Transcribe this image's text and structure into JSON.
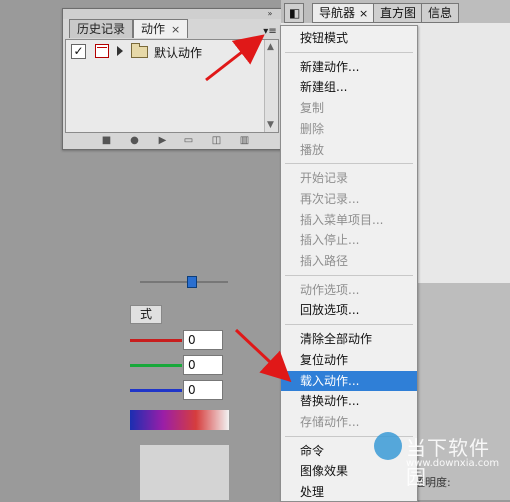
{
  "actions_panel": {
    "tabs": [
      {
        "label": "历史记录",
        "active": false
      },
      {
        "label": "动作",
        "active": true,
        "close": "×"
      }
    ],
    "collapse_icon": "»",
    "menu_icon": "▾≡",
    "rows": [
      {
        "checked": "✓",
        "label": "默认动作"
      }
    ],
    "footer_icons": [
      "stop-icon",
      "record-icon",
      "play-icon",
      "folder-icon",
      "new-action-icon",
      "trash-icon"
    ]
  },
  "navigator_panel": {
    "tabs": [
      {
        "label": "导航器",
        "active": true,
        "close": "×"
      },
      {
        "label": "直方图",
        "active": false
      },
      {
        "label": "信息",
        "active": false
      }
    ],
    "color_tab_label": "式",
    "channels": [
      {
        "name": "red",
        "color": "#c81e1e",
        "value": "0"
      },
      {
        "name": "green",
        "color": "#18a83a",
        "value": "0"
      },
      {
        "name": "blue",
        "color": "#1f35c9",
        "value": "0"
      }
    ],
    "side_label": "透明度:"
  },
  "context_menu": {
    "items": [
      {
        "label": "按钮模式",
        "disabled": false,
        "selected": false
      },
      {
        "sep": true
      },
      {
        "label": "新建动作...",
        "disabled": false,
        "selected": false
      },
      {
        "label": "新建组...",
        "disabled": false,
        "selected": false
      },
      {
        "label": "复制",
        "disabled": true,
        "selected": false
      },
      {
        "label": "删除",
        "disabled": true,
        "selected": false
      },
      {
        "label": "播放",
        "disabled": true,
        "selected": false
      },
      {
        "sep": true
      },
      {
        "label": "开始记录",
        "disabled": true,
        "selected": false
      },
      {
        "label": "再次记录...",
        "disabled": true,
        "selected": false
      },
      {
        "label": "插入菜单项目...",
        "disabled": true,
        "selected": false
      },
      {
        "label": "插入停止...",
        "disabled": true,
        "selected": false
      },
      {
        "label": "插入路径",
        "disabled": true,
        "selected": false
      },
      {
        "sep": true
      },
      {
        "label": "动作选项...",
        "disabled": true,
        "selected": false
      },
      {
        "label": "回放选项...",
        "disabled": false,
        "selected": false
      },
      {
        "sep": true
      },
      {
        "label": "清除全部动作",
        "disabled": false,
        "selected": false
      },
      {
        "label": "复位动作",
        "disabled": false,
        "selected": false
      },
      {
        "label": "载入动作...",
        "disabled": false,
        "selected": true
      },
      {
        "label": "替换动作...",
        "disabled": false,
        "selected": false
      },
      {
        "label": "存储动作...",
        "disabled": true,
        "selected": false
      },
      {
        "sep": true
      },
      {
        "label": "命令",
        "disabled": false,
        "selected": false
      },
      {
        "label": "图像效果",
        "disabled": false,
        "selected": false
      },
      {
        "label": "处理",
        "disabled": false,
        "selected": false
      }
    ]
  },
  "watermark": {
    "brand": "当下软件园",
    "url": "www.downxia.com"
  },
  "colors": {
    "selection": "#2f7fd7",
    "arrow": "#e01818"
  }
}
